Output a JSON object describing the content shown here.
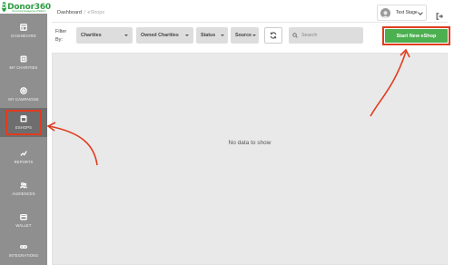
{
  "brand": {
    "logo_text": "Donor360",
    "logo_mark": "D",
    "tagline": "Community Engagement Platform",
    "color": "#2f9e44"
  },
  "sidebar": {
    "items": [
      {
        "label": "Dashboard",
        "icon": "dashboard-icon"
      },
      {
        "label": "My Charities",
        "icon": "charities-icon"
      },
      {
        "label": "My Campaigns",
        "icon": "campaigns-icon"
      },
      {
        "label": "eShops",
        "icon": "shop-icon",
        "active": true
      },
      {
        "label": "Reports",
        "icon": "reports-icon"
      },
      {
        "label": "Audiences",
        "icon": "audiences-icon"
      },
      {
        "label": "Wallet",
        "icon": "wallet-icon"
      },
      {
        "label": "Integrations",
        "icon": "link-icon"
      }
    ]
  },
  "header": {
    "breadcrumb": {
      "root": "Dashboard",
      "separator": "/",
      "current": "eShops"
    },
    "user": {
      "name": "Test Stage",
      "icon": "user-avatar-icon"
    },
    "logout_icon": "logout-icon"
  },
  "filters": {
    "label": "Filter By:",
    "dropdowns": [
      {
        "label": "Charities"
      },
      {
        "label": "Owned Charities"
      },
      {
        "label": "Status"
      },
      {
        "label": "Source"
      }
    ],
    "refresh_icon": "refresh-icon",
    "search": {
      "placeholder": "Search",
      "value": ""
    }
  },
  "actions": {
    "start_label": "Start New eShop",
    "color": "#4caf50"
  },
  "main": {
    "empty_text": "No data to show"
  },
  "annotation_color": "#e03c1f"
}
